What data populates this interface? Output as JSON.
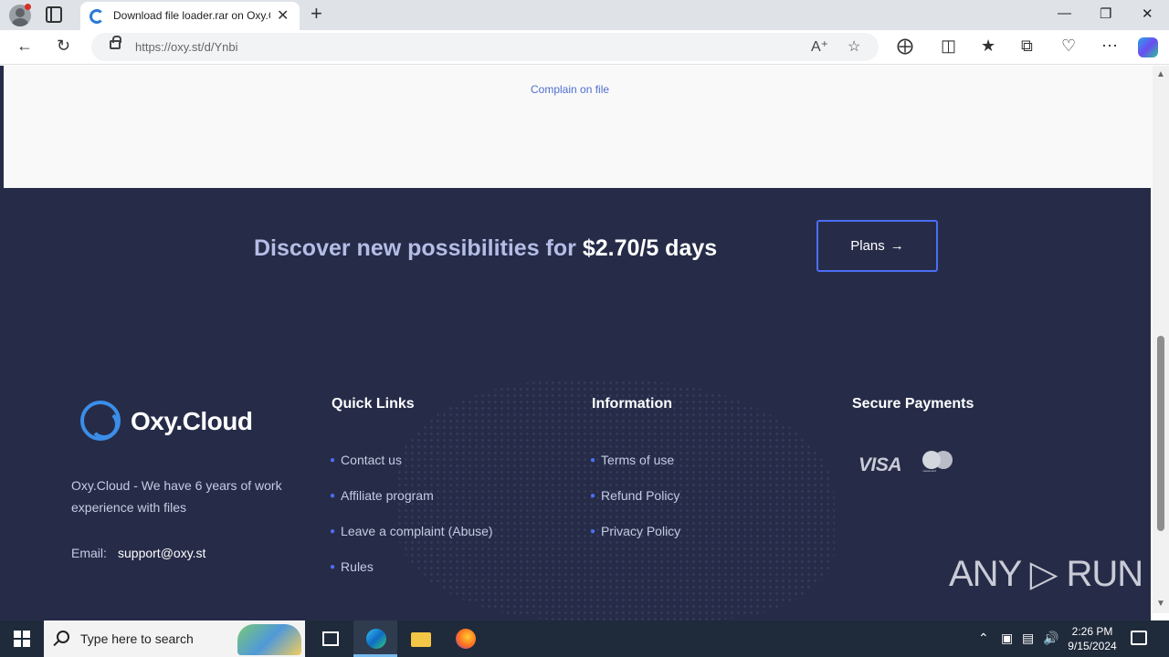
{
  "browser": {
    "tab_title": "Download file loader.rar on Oxy.Cloud",
    "url_host": "https://oxy.st",
    "url_path": "/d/Ynbi",
    "new_tab_glyph": "+",
    "tab_close_glyph": "✕"
  },
  "page": {
    "complain_link": "Complain on file",
    "promo_text": "Discover new possibilities for ",
    "promo_price": "$2.70/5 days",
    "plans_button": "Plans",
    "plans_arrow": "→",
    "logo_text": "Oxy.Cloud",
    "about_text": "Oxy.Cloud - We have 6 years of work experience with files",
    "email_label": "Email:",
    "email_value": "support@oxy.st",
    "quick_links": {
      "heading": "Quick Links",
      "items": [
        "Contact us",
        "Affiliate program",
        "Leave a complaint (Abuse)",
        "Rules"
      ]
    },
    "information": {
      "heading": "Information",
      "items": [
        "Terms of use",
        "Refund Policy",
        "Privacy Policy"
      ]
    },
    "payments": {
      "heading": "Secure Payments",
      "visa": "VISA",
      "mastercard": "mastercard"
    },
    "watermark": "ANY ▷ RUN"
  },
  "taskbar": {
    "search_placeholder": "Type here to search",
    "time": "2:26 PM",
    "date": "9/15/2024"
  },
  "colors": {
    "footer_bg": "#262c48",
    "accent": "#4c6ef5",
    "promo_text": "#b4bde6"
  }
}
